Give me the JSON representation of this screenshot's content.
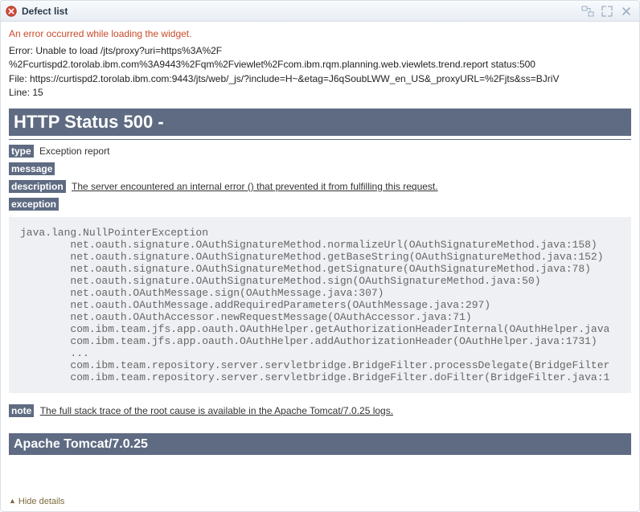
{
  "titlebar": {
    "title": "Defect list"
  },
  "error": {
    "message": "An error occurred while loading the widget.",
    "line1": "Error: Unable to load /jts/proxy?uri=https%3A%2F",
    "line2": "%2Fcurtispd2.torolab.ibm.com%3A9443%2Fqm%2Fviewlet%2Fcom.ibm.rqm.planning.web.viewlets.trend.report status:500",
    "line3": "File: https://curtispd2.torolab.ibm.com:9443/jts/web/_js/?include=H~&etag=J6qSoubLWW_en_US&_proxyURL=%2Fjts&ss=BJriV",
    "line4": "Line: 15"
  },
  "http": {
    "status_header": "HTTP Status 500 -",
    "type_label": "type",
    "type_value": "Exception report",
    "message_label": "message",
    "description_label": "description",
    "description_value": "The server encountered an internal error () that prevented it from fulfilling this request.",
    "exception_label": "exception",
    "stack": "java.lang.NullPointerException\n\tnet.oauth.signature.OAuthSignatureMethod.normalizeUrl(OAuthSignatureMethod.java:158)\n\tnet.oauth.signature.OAuthSignatureMethod.getBaseString(OAuthSignatureMethod.java:152)\n\tnet.oauth.signature.OAuthSignatureMethod.getSignature(OAuthSignatureMethod.java:78)\n\tnet.oauth.signature.OAuthSignatureMethod.sign(OAuthSignatureMethod.java:50)\n\tnet.oauth.OAuthMessage.sign(OAuthMessage.java:307)\n\tnet.oauth.OAuthMessage.addRequiredParameters(OAuthMessage.java:297)\n\tnet.oauth.OAuthAccessor.newRequestMessage(OAuthAccessor.java:71)\n\tcom.ibm.team.jfs.app.oauth.OAuthHelper.getAuthorizationHeaderInternal(OAuthHelper.java\n\tcom.ibm.team.jfs.app.oauth.OAuthHelper.addAuthorizationHeader(OAuthHelper.java:1731)\n\t...\n\tcom.ibm.team.repository.server.servletbridge.BridgeFilter.processDelegate(BridgeFilter\n\tcom.ibm.team.repository.server.servletbridge.BridgeFilter.doFilter(BridgeFilter.java:1",
    "note_label": "note",
    "note_value": "The full stack trace of the root cause is available in the Apache Tomcat/7.0.25 logs.",
    "server_header": "Apache Tomcat/7.0.25"
  },
  "footer": {
    "hide_details": "Hide details"
  }
}
